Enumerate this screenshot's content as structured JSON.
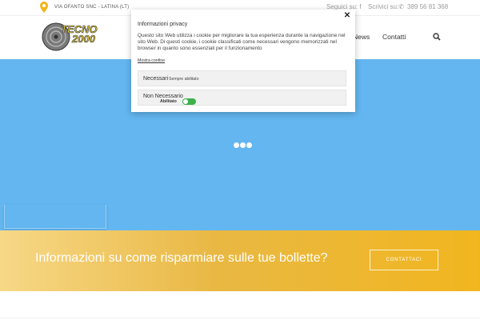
{
  "colors": {
    "hero": "#63b6f0",
    "cta_start": "#f7d887",
    "cta_end": "#f1b61f",
    "toggle_on": "#3cb14a",
    "pin": "#f2b51b"
  },
  "topbar": {
    "address": "VIA OFANTO SNC - LATINA (LT)",
    "pin_icon": "map-pin-icon",
    "follow_label": "Seguici su:",
    "follow_icon": "facebook-icon",
    "write_label": "Scrivici su:",
    "write_icon": "whatsapp-icon",
    "phone": "389 56 81 368"
  },
  "header": {
    "logo_line1": "TECNO",
    "logo_line2": "2000",
    "nav": {
      "news": "News",
      "contatti": "Contatti"
    },
    "search_icon": "search-icon"
  },
  "hero": {
    "loader_icon": "loading-dots-icon"
  },
  "cta": {
    "text": "Informazioni su come risparmiare sulle tue bollette?",
    "button": "CONTATTACI"
  },
  "privacy_modal": {
    "close_icon": "close-icon",
    "title": "Informazioni privacy",
    "body": "Questo sito Web utilizza i cookie per migliorare la tua esperienza durante la navigazione nel sito Web. Di questi cookie, i cookie classificati come necessari vengono memorizzati nel browser in quanto sono essenziali per il funzionamento",
    "link": "Mostra confine",
    "options": [
      {
        "label": "Necessari",
        "status": "Sempre abilitato"
      },
      {
        "label": "Non Necessario",
        "status": "Abilitato",
        "enabled": true
      }
    ]
  }
}
